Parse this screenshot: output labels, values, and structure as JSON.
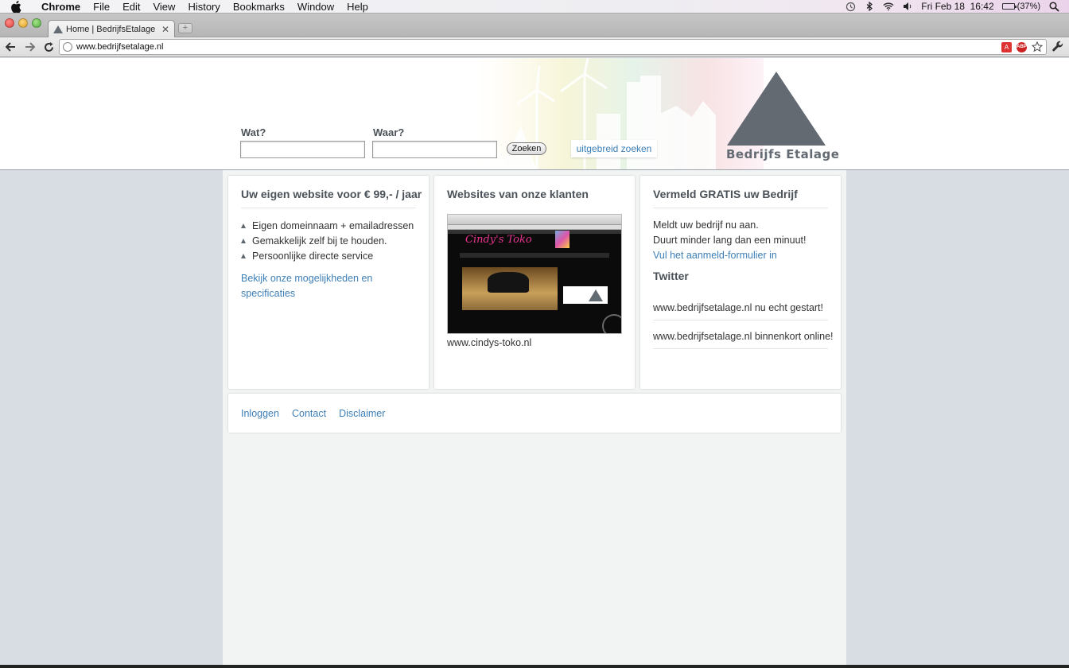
{
  "menubar": {
    "items": [
      "Chrome",
      "File",
      "Edit",
      "View",
      "History",
      "Bookmarks",
      "Window",
      "Help"
    ],
    "clock": "Fri Feb 18  16:42",
    "battery_text": "(37%)",
    "battery_level": 0.37
  },
  "browser": {
    "tab_title": "Home | BedrijfsEtalage | Bedrijfs",
    "url": "www.bedrijfsetalage.nl"
  },
  "header": {
    "search": {
      "what_label": "Wat?",
      "where_label": "Waar?",
      "what_value": "",
      "where_value": "",
      "button_label": "Zoeken",
      "advanced_link": "uitgebreid zoeken"
    },
    "logo_text": "Bedrijfs Etalage"
  },
  "cards": {
    "website": {
      "title": "Uw eigen website voor € 99,- / jaar",
      "bullets": [
        "Eigen domeinnaam + emailadressen",
        "Gemakkelijk zelf bij te houden.",
        "Persoonlijke directe service"
      ],
      "link": "Bekijk onze mogelijkheden en specificaties"
    },
    "clients": {
      "title": "Websites van onze klanten",
      "thumb_brand": "Cindy's Toko",
      "caption": "www.cindys-toko.nl"
    },
    "register": {
      "title": "Vermeld GRATIS uw Bedrijf",
      "line1": "Meldt uw bedrijf nu aan.",
      "line2": "Duurt minder lang dan een minuut!",
      "link": "Vul het aanmeld-formulier in",
      "twitter_title": "Twitter",
      "tweets": [
        "www.bedrijfsetalage.nl nu echt gestart!",
        "www.bedrijfsetalage.nl binnenkort online!"
      ]
    }
  },
  "footer": {
    "links": [
      "Inloggen",
      "Contact",
      "Disclaimer"
    ]
  },
  "colors": {
    "link": "#3d7fb7",
    "heading": "#4a5158",
    "logo": "#636a72",
    "page_bg": "#d8dde4"
  }
}
